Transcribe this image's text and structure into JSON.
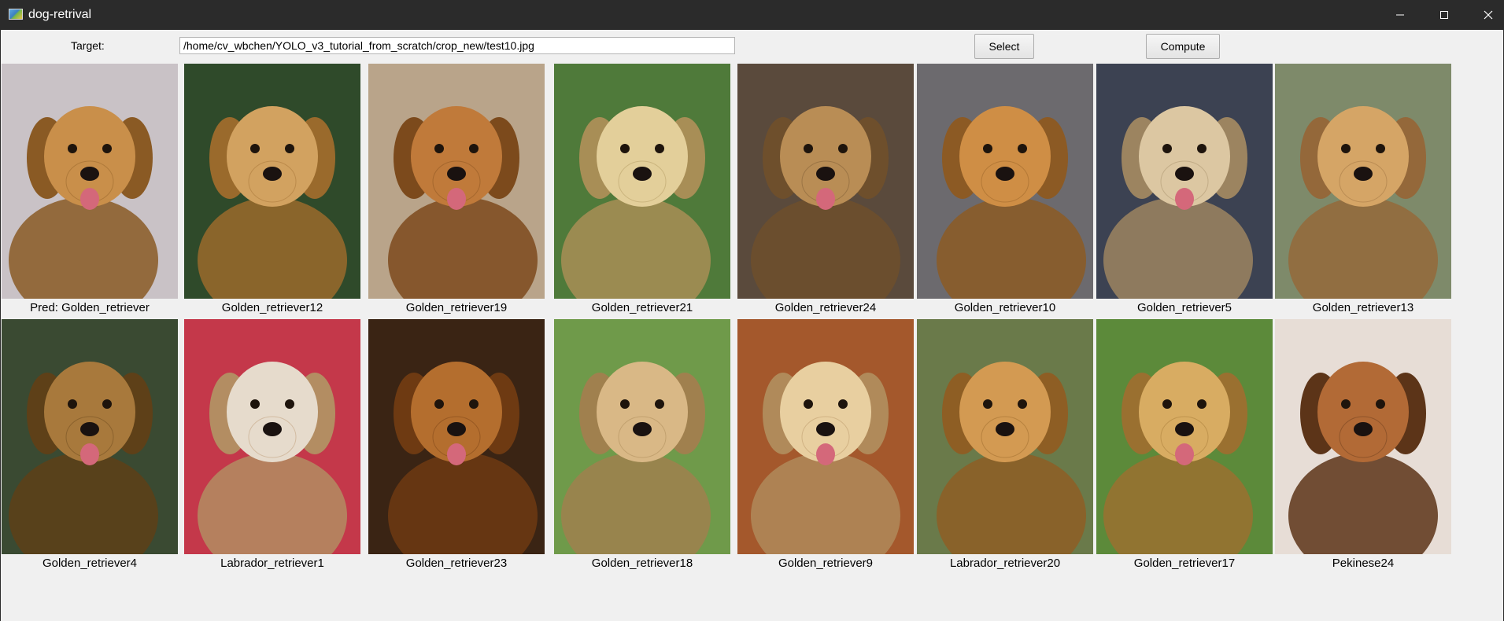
{
  "window": {
    "title": "dog-retrival",
    "controls": [
      "minimize-icon",
      "maximize-icon",
      "close-icon"
    ]
  },
  "toolbar": {
    "target_label": "Target:",
    "path_value": "/home/cv_wbchen/YOLO_v3_tutorial_from_scratch/crop_new/test10.jpg",
    "select_label": "Select",
    "compute_label": "Compute"
  },
  "results": {
    "row1": [
      {
        "label": "Pred: Golden_retriever",
        "bg": "#c9c2c6",
        "fur": "#c98f4a",
        "dark": "#8a5a24"
      },
      {
        "label": "Golden_retriever12",
        "bg": "#2f4a2a",
        "fur": "#d2a260",
        "dark": "#9a6a2c"
      },
      {
        "label": "Golden_retriever19",
        "bg": "#b9a48a",
        "fur": "#c07a3a",
        "dark": "#7c4a1c"
      },
      {
        "label": "Golden_retriever21",
        "bg": "#4f7a3a",
        "fur": "#e3cf9a",
        "dark": "#a88e56"
      },
      {
        "label": "Golden_retriever24",
        "bg": "#5a4a3c",
        "fur": "#b98d55",
        "dark": "#6e4f2c"
      },
      {
        "label": "Golden_retriever10",
        "bg": "#6c6a6e",
        "fur": "#cf8e45",
        "dark": "#8c5a24"
      },
      {
        "label": "Golden_retriever5",
        "bg": "#3c4252",
        "fur": "#dcc7a2",
        "dark": "#9c8460"
      },
      {
        "label": "Golden_retriever13",
        "bg": "#7e8a6a",
        "fur": "#d5a566",
        "dark": "#94683a"
      }
    ],
    "row2": [
      {
        "label": "Golden_retriever4",
        "bg": "#3a4a32",
        "fur": "#a8793c",
        "dark": "#5e4018"
      },
      {
        "label": "Labrador_retriever1",
        "bg": "#c4384a",
        "fur": "#e6dbcc",
        "dark": "#b38d62"
      },
      {
        "label": "Golden_retriever23",
        "bg": "#3a2414",
        "fur": "#b46e2e",
        "dark": "#6e3a12"
      },
      {
        "label": "Golden_retriever18",
        "bg": "#6f9a4a",
        "fur": "#d9b886",
        "dark": "#a0804e"
      },
      {
        "label": "Golden_retriever9",
        "bg": "#a4582c",
        "fur": "#e8cfa0",
        "dark": "#b08a5a"
      },
      {
        "label": "Labrador_retriever20",
        "bg": "#6a7a4a",
        "fur": "#d39a52",
        "dark": "#8e5e24"
      },
      {
        "label": "Golden_retriever17",
        "bg": "#5c8a3a",
        "fur": "#d8ac62",
        "dark": "#9a7030"
      },
      {
        "label": "Pekinese24",
        "bg": "#e7ddd6",
        "fur": "#b26a36",
        "dark": "#5c3418"
      }
    ]
  }
}
